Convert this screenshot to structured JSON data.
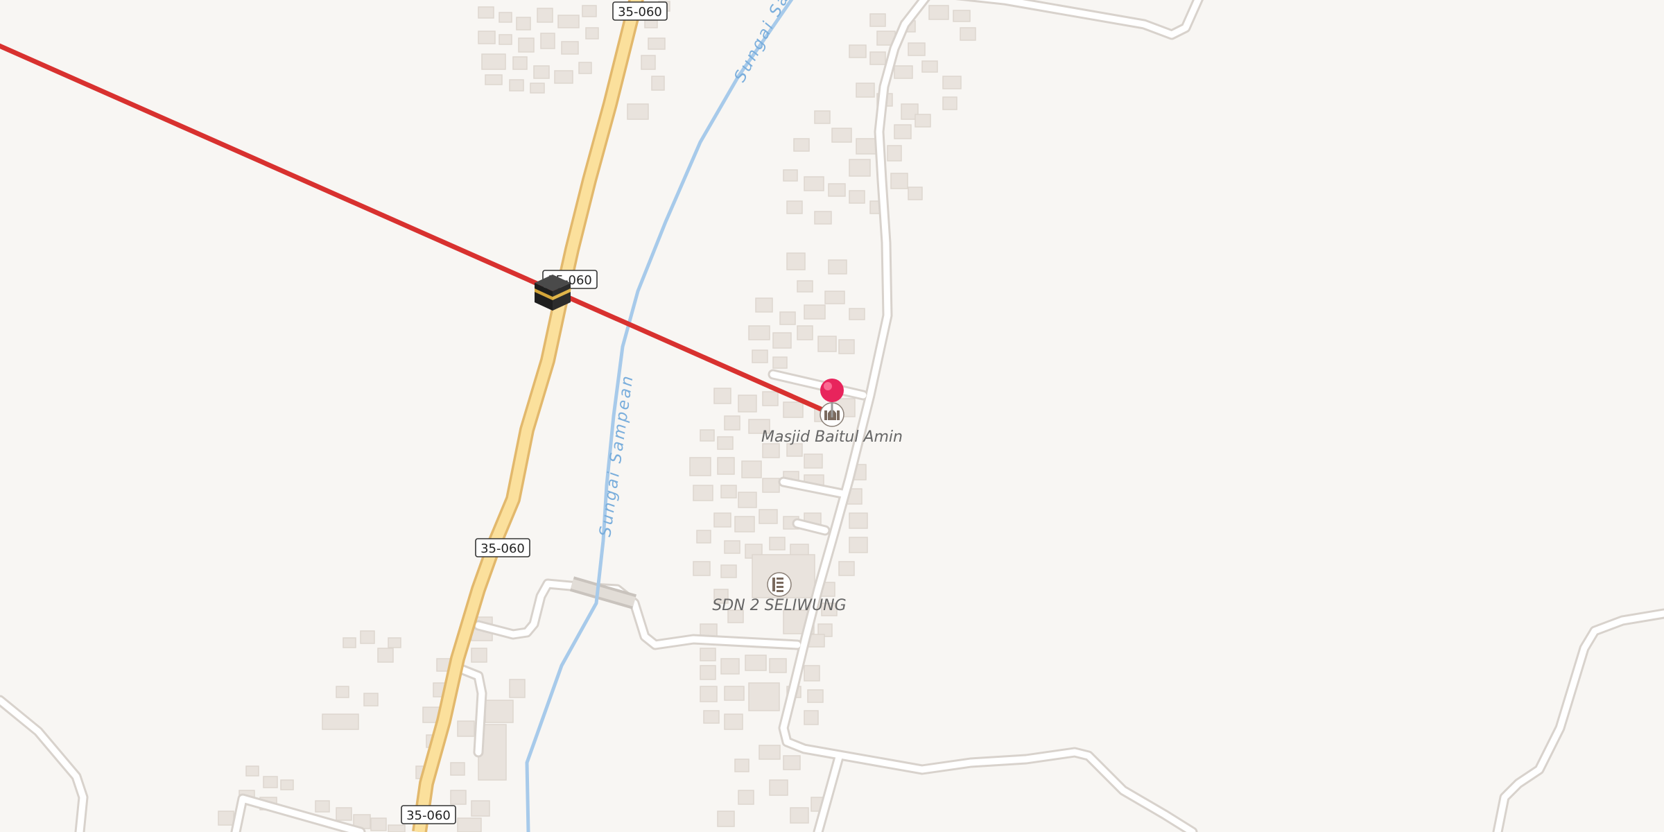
{
  "map": {
    "route_shields": [
      "35-060",
      "35-060",
      "35-060",
      "35-060"
    ],
    "river_labels": [
      "Sungai Sampean",
      "Sungai Sampean"
    ],
    "pois": [
      {
        "name": "Masjid Baitul Amin",
        "icon": "mosque-icon"
      },
      {
        "name": "SDN 2 SELIWUNG",
        "icon": "school-icon"
      }
    ],
    "qibla_marker": {
      "icon": "kaaba-icon"
    },
    "location_marker": {
      "icon": "map-pin-icon",
      "color": "#e8245c"
    },
    "colors": {
      "background": "#f8f6f3",
      "qibla_line": "#d8312f",
      "highway": "#fbe09c",
      "river": "#a7caea"
    }
  }
}
